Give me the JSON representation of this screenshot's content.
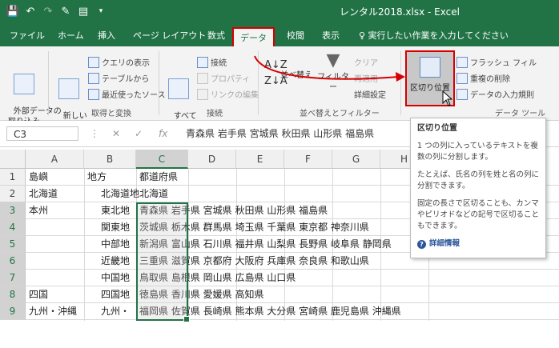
{
  "window": {
    "title": "レンタル2018.xlsx - Excel"
  },
  "tabs": [
    {
      "label": "ファイル"
    },
    {
      "label": "ホーム"
    },
    {
      "label": "挿入"
    },
    {
      "label": "ページ レイアウト"
    },
    {
      "label": "数式"
    },
    {
      "label": "データ"
    },
    {
      "label": "校閲"
    },
    {
      "label": "表示"
    }
  ],
  "tell_me": "♀ 実行したい作業を入力してください",
  "ribbon": {
    "external_data": "外部データの\n取り込み",
    "new_query": "新しい\nクエリ",
    "show_queries": "クエリの表示",
    "from_table": "テーブルから",
    "recent_sources": "最近使ったソース",
    "group_get_transform": "取得と変換",
    "refresh_all": "すべて\n更新",
    "connections": "接続",
    "properties": "プロパティ",
    "edit_links": "リンクの編集",
    "group_connections": "接続",
    "sort": "並べ替え",
    "filter": "フィルター",
    "clear": "クリア",
    "reapply": "再適用",
    "advanced": "詳細設定",
    "group_sort_filter": "並べ替えとフィルター",
    "text_to_columns": "区切り位置",
    "flash_fill": "フラッシュ フィル",
    "remove_duplicates": "重複の削除",
    "data_validation": "データの入力規則",
    "group_data_tools": "データ ツール"
  },
  "formula_bar": {
    "name_box": "C3",
    "content": "青森県 岩手県 宮城県 秋田県 山形県 福島県"
  },
  "columns": [
    "A",
    "B",
    "C",
    "D",
    "E",
    "F",
    "G",
    "H"
  ],
  "rows": [
    "1",
    "2",
    "3",
    "4",
    "5",
    "6",
    "7",
    "8",
    "9"
  ],
  "cells": {
    "A": [
      "島嶼",
      "北海道",
      "本州",
      "",
      "",
      "",
      "",
      "四国",
      "九州・沖縄"
    ],
    "B": [
      "地方",
      "北海道地",
      "東北地",
      "関東地",
      "中部地",
      "近畿地",
      "中国地",
      "四国地",
      "九州・"
    ],
    "C": [
      "都道府県",
      "北海道",
      "青森県 岩手県 宮城県 秋田県 山形県 福島県",
      "茨城県 栃木県 群馬県 埼玉県 千葉県 東京都 神奈川県",
      "新潟県 富山県 石川県 福井県 山梨県 長野県 岐阜県 静岡県",
      "三重県 滋賀県 京都府 大阪府 兵庫県 奈良県 和歌山県",
      "鳥取県 島根県 岡山県 広島県 山口県",
      "徳島県 香川県 愛媛県 高知県",
      "福岡県 佐賀県 長崎県 熊本県 大分県 宮崎県 鹿児島県 沖縄県"
    ]
  },
  "tooltip": {
    "title": "区切り位置",
    "p1": "1 つの列に入っているテキストを複数の列に分割します。",
    "p2": "たとえば、氏名の列を姓と名の列に分割できます。",
    "p3": "固定の長さで区切ることも、カンマやピリオドなどの記号で区切ることもできます。",
    "more": "詳細情報"
  },
  "colors": {
    "excel_green": "#217346",
    "highlight_red": "#d60000"
  }
}
